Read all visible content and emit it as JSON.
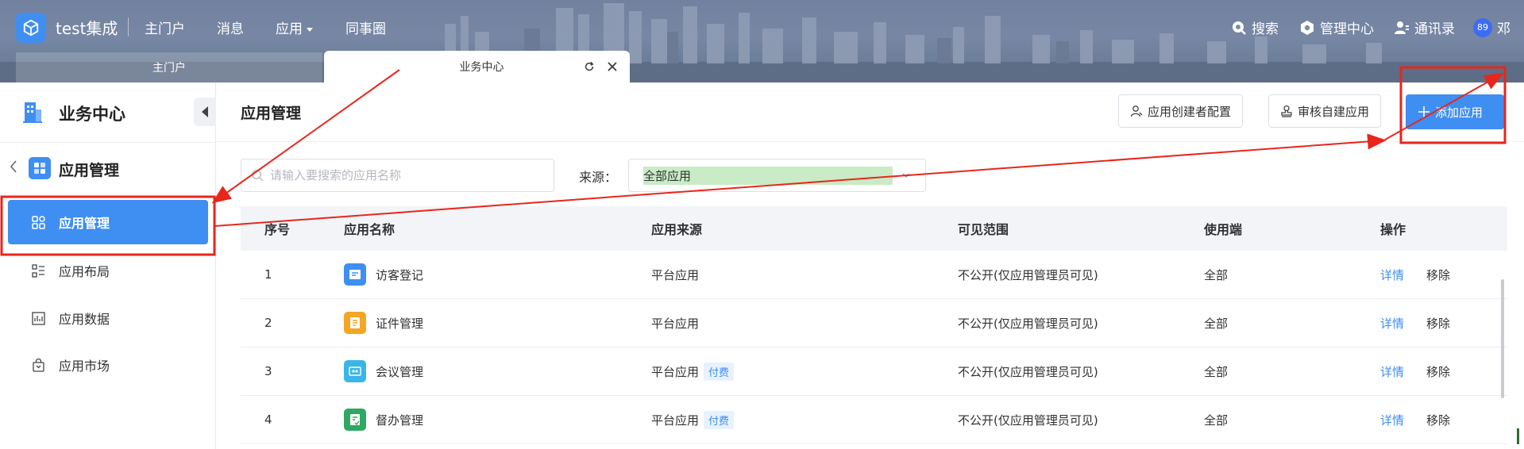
{
  "header": {
    "brand": "test集成",
    "nav": [
      "主门户",
      "消息",
      "应用",
      "同事圈"
    ],
    "right": {
      "search": "搜索",
      "admin": "管理中心",
      "contacts": "通讯录",
      "badge": "89",
      "user": "邓"
    }
  },
  "tabs": {
    "inactive": "主门户",
    "active": "业务中心"
  },
  "sidebar": {
    "title": "业务中心",
    "group": "应用管理",
    "items": [
      {
        "label": "应用管理",
        "icon": "grid-icon",
        "active": true
      },
      {
        "label": "应用布局",
        "icon": "list-icon",
        "active": false
      },
      {
        "label": "应用数据",
        "icon": "chart-icon",
        "active": false
      },
      {
        "label": "应用市场",
        "icon": "bag-icon",
        "active": false
      }
    ]
  },
  "main": {
    "title": "应用管理",
    "buttons": {
      "creator_config": "应用创建者配置",
      "review": "审核自建应用",
      "add": "添加应用"
    },
    "search_placeholder": "请输入要搜索的应用名称",
    "filter_label": "来源：",
    "filter_value": "全部应用",
    "table": {
      "headers": [
        "序号",
        "应用名称",
        "应用来源",
        "可见范围",
        "使用端",
        "操作"
      ],
      "rows": [
        {
          "no": "1",
          "name": "访客登记",
          "source": "平台应用",
          "paid": "",
          "scope": "不公开(仅应用管理员可见)",
          "client": "全部",
          "detail": "详情",
          "remove": "移除",
          "color": "#3f8ef2"
        },
        {
          "no": "2",
          "name": "证件管理",
          "source": "平台应用",
          "paid": "",
          "scope": "不公开(仅应用管理员可见)",
          "client": "全部",
          "detail": "详情",
          "remove": "移除",
          "color": "#f5a623"
        },
        {
          "no": "3",
          "name": "会议管理",
          "source": "平台应用",
          "paid": "付费",
          "scope": "不公开(仅应用管理员可见)",
          "client": "全部",
          "detail": "详情",
          "remove": "移除",
          "color": "#3bb5e8"
        },
        {
          "no": "4",
          "name": "督办管理",
          "source": "平台应用",
          "paid": "付费",
          "scope": "不公开(仅应用管理员可见)",
          "client": "全部",
          "detail": "详情",
          "remove": "移除",
          "color": "#2fa862"
        }
      ]
    }
  },
  "colors": {
    "primary": "#3f8ef2",
    "annotation": "#e8261c"
  }
}
